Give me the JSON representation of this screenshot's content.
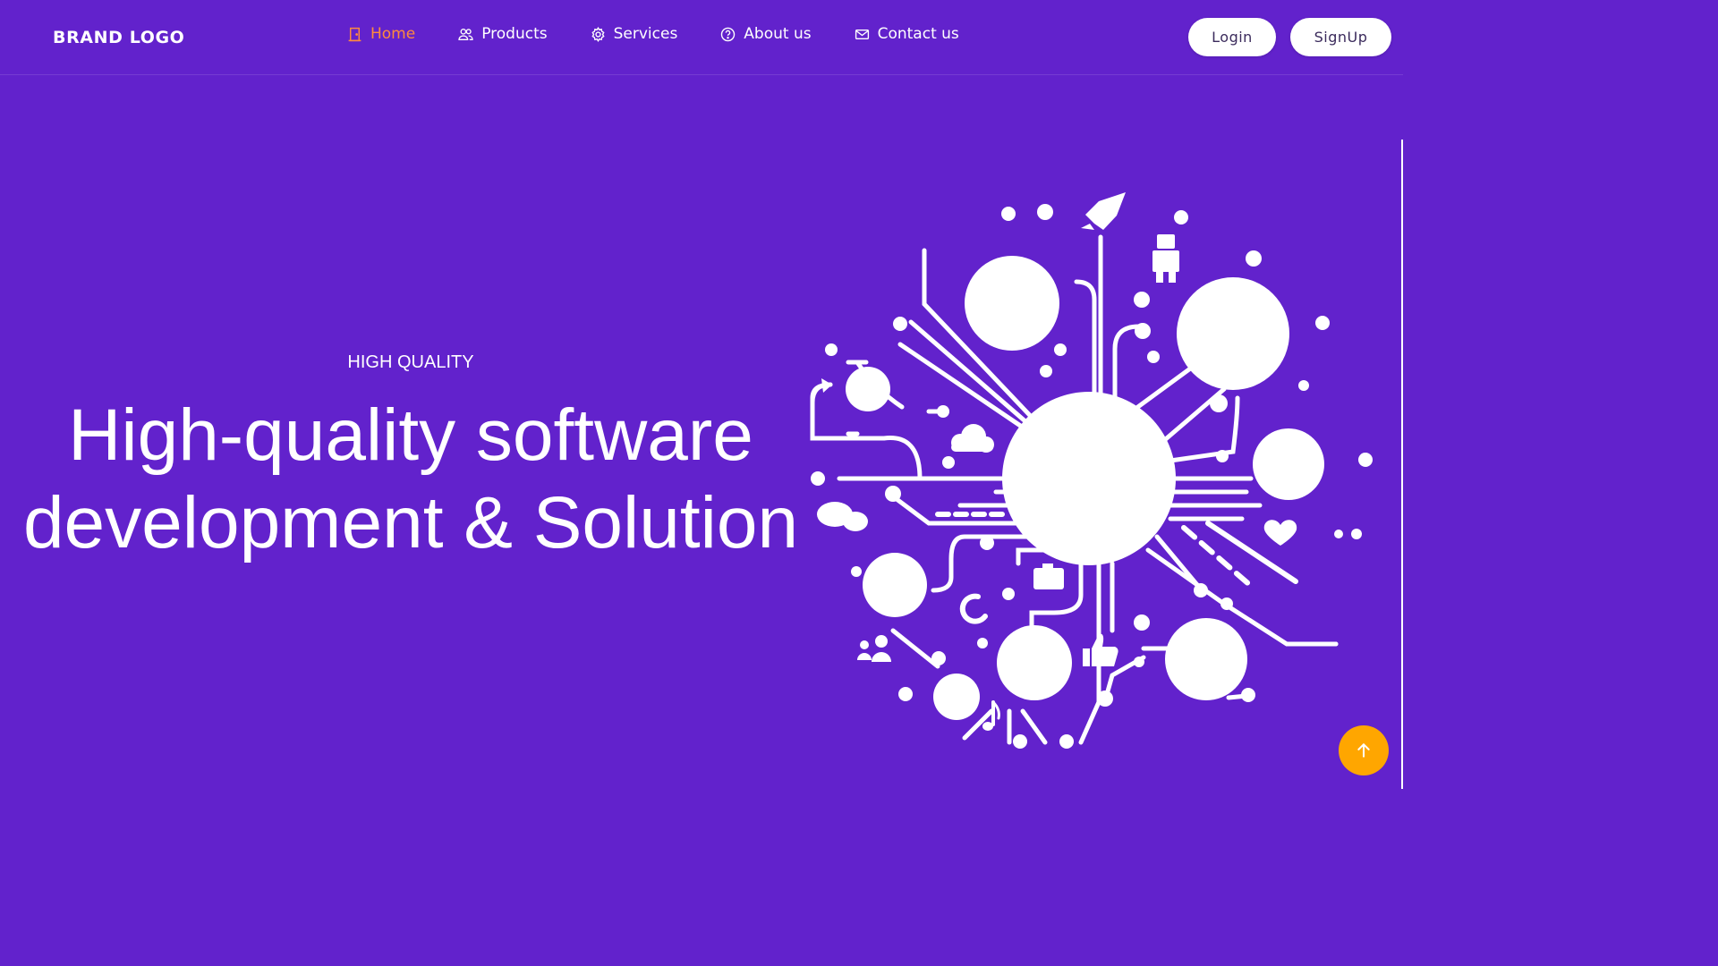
{
  "brand": {
    "logo_text": "BRAND LOGO"
  },
  "nav": {
    "items": [
      {
        "label": "Home",
        "icon": "door-icon",
        "active": true
      },
      {
        "label": "Products",
        "icon": "users-icon",
        "active": false
      },
      {
        "label": "Services",
        "icon": "gear-icon",
        "active": false
      },
      {
        "label": "About us",
        "icon": "question-circle-icon",
        "active": false
      },
      {
        "label": "Contact us",
        "icon": "envelope-icon",
        "active": false
      }
    ]
  },
  "auth": {
    "login_label": "Login",
    "signup_label": "SignUp"
  },
  "hero": {
    "eyebrow": "HIGH QUALITY",
    "title_line1": "High-quality software",
    "title_line2": "development & Solution"
  },
  "colors": {
    "background": "#6222cc",
    "active_nav": "#ff8a3d",
    "scroll_button": "#ffa600",
    "text": "#ffffff"
  },
  "scroll_top": {
    "icon": "arrow-up-icon"
  }
}
